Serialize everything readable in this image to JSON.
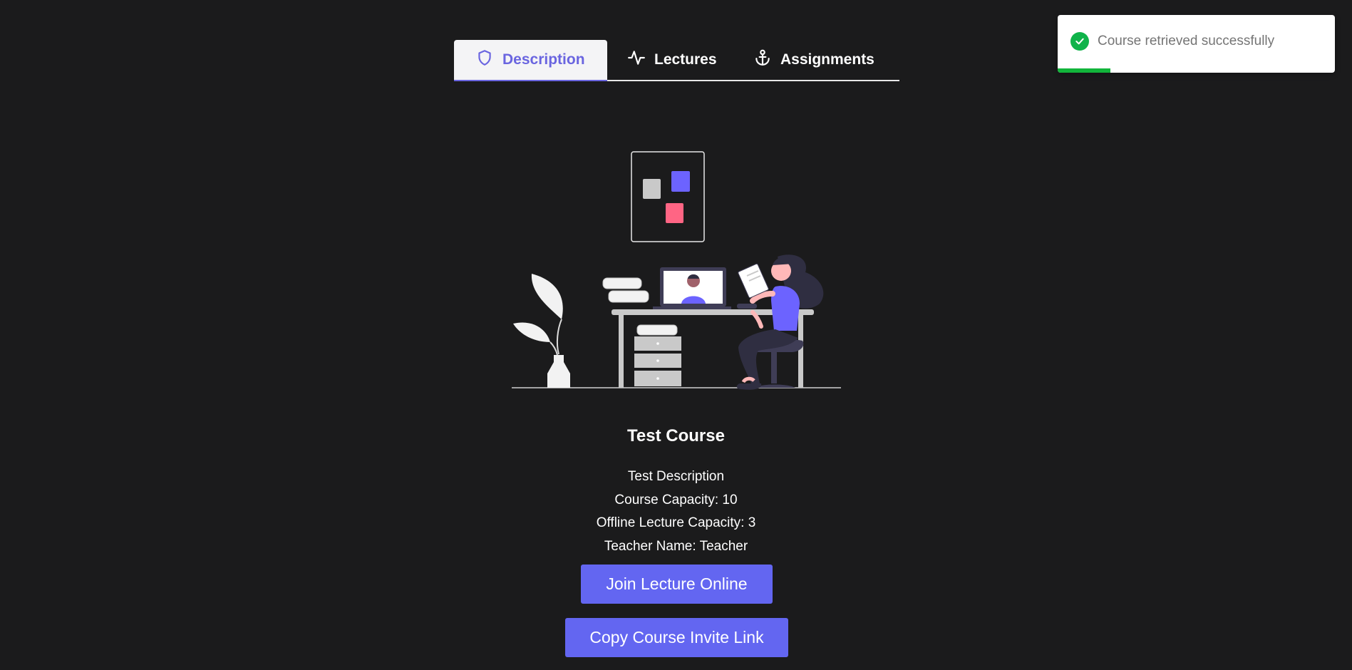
{
  "tabs": [
    {
      "label": "Description",
      "icon": "shield-icon",
      "active": true
    },
    {
      "label": "Lectures",
      "icon": "activity-icon",
      "active": false
    },
    {
      "label": "Assignments",
      "icon": "anchor-icon",
      "active": false
    }
  ],
  "toast": {
    "message": "Course retrieved successfully",
    "icon": "check-circle-icon",
    "progress": 0.19,
    "color": "#12b53b"
  },
  "course": {
    "title": "Test Course",
    "description": "Test Description",
    "capacity": "Course Capacity: 10",
    "offline_capacity": "Offline Lecture Capacity: 3",
    "teacher": "Teacher Name: Teacher"
  },
  "buttons": {
    "join": "Join Lecture Online",
    "copy": "Copy Course Invite Link"
  },
  "colors": {
    "accent": "#6366f1",
    "background": "#1b1b1c"
  }
}
